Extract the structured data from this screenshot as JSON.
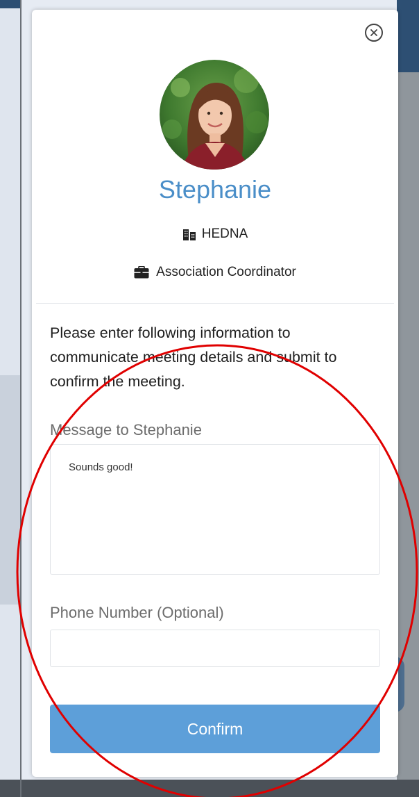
{
  "profile": {
    "name": "Stephanie",
    "organization": "HEDNA",
    "title": "Association Coordinator"
  },
  "form": {
    "instructions": "Please enter following information to communicate meeting details and submit to confirm the meeting.",
    "message_label": "Message to Stephanie",
    "message_value": "Sounds good!",
    "phone_label": "Phone Number (Optional)",
    "phone_value": "",
    "confirm_label": "Confirm"
  },
  "icons": {
    "close": "close-circle-icon",
    "organization": "building-icon",
    "title": "briefcase-icon"
  },
  "colors": {
    "accent": "#4a8ec8",
    "button": "#5d9fd9",
    "header": "#2d4f73",
    "annotation": "#e00000"
  }
}
